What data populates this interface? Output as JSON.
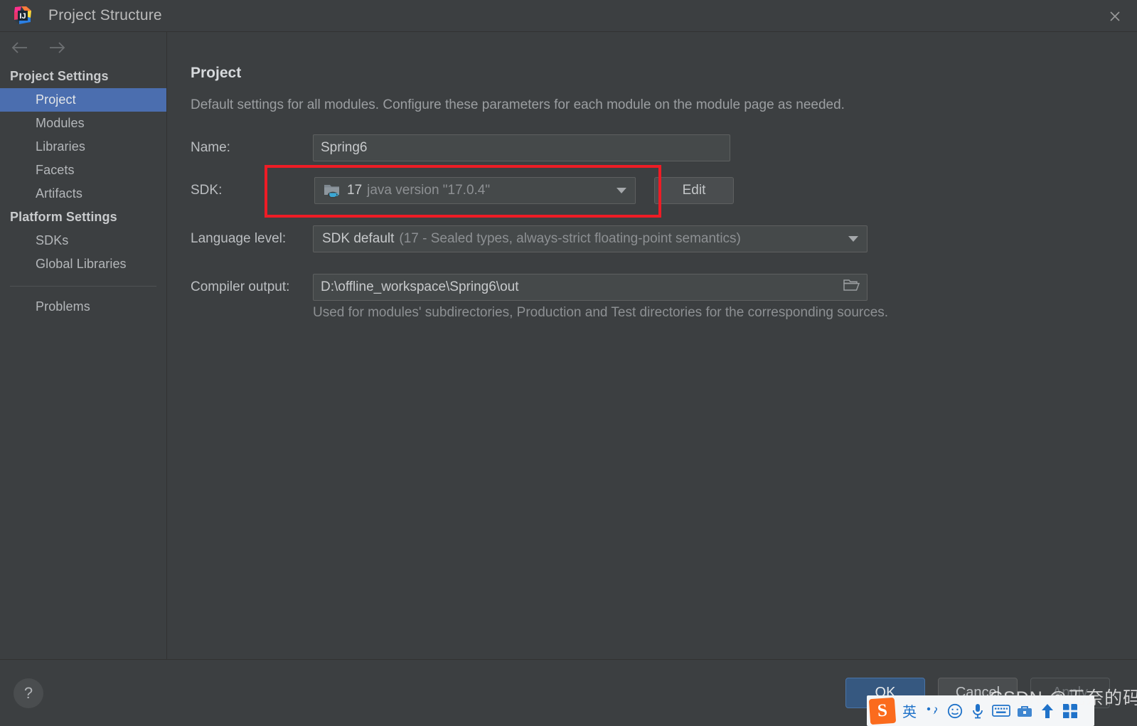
{
  "window": {
    "title": "Project Structure",
    "app_icon": "intellij-idea-logo",
    "close_icon": "close-icon"
  },
  "navbar": {
    "back_icon": "arrow-left-icon",
    "forward_icon": "arrow-right-icon"
  },
  "sidebar": {
    "groups": [
      {
        "label": "Project Settings",
        "items": [
          {
            "label": "Project",
            "selected": true
          },
          {
            "label": "Modules",
            "selected": false
          },
          {
            "label": "Libraries",
            "selected": false
          },
          {
            "label": "Facets",
            "selected": false
          },
          {
            "label": "Artifacts",
            "selected": false
          }
        ]
      },
      {
        "label": "Platform Settings",
        "items": [
          {
            "label": "SDKs",
            "selected": false
          },
          {
            "label": "Global Libraries",
            "selected": false
          }
        ]
      }
    ],
    "extra_item": {
      "label": "Problems",
      "selected": false
    }
  },
  "main": {
    "title": "Project",
    "description": "Default settings for all modules. Configure these parameters for each module on the module page as needed.",
    "fields": {
      "name": {
        "label": "Name:",
        "value": "Spring6"
      },
      "sdk": {
        "label": "SDK:",
        "icon": "java-sdk-folder-icon",
        "value_strong": "17",
        "value_dim": "java version \"17.0.4\"",
        "caret_icon": "chevron-down-icon",
        "edit_button": "Edit"
      },
      "language_level": {
        "label": "Language level:",
        "value_strong": "SDK default",
        "value_dim": "(17 - Sealed types, always-strict floating-point semantics)",
        "caret_icon": "chevron-down-icon"
      },
      "compiler_output": {
        "label": "Compiler output:",
        "value": "D:\\offline_workspace\\Spring6\\out",
        "browse_icon": "folder-open-icon",
        "hint": "Used for modules' subdirectories, Production and Test directories for the corresponding sources."
      }
    }
  },
  "annotation": {
    "highlight_color": "#ee1c25",
    "target": "sdk-field"
  },
  "footer": {
    "help_icon": "?",
    "ok_label": "OK",
    "cancel_label": "Cancel",
    "apply_label": "Apply"
  },
  "ime_toolbar": {
    "logo": "S",
    "mode": "英",
    "punctuation_icon": "punctuation-toggle-icon",
    "emoji_icon": "☺",
    "mic_icon": "microphone-icon",
    "keyboard_icon": "keyboard-icon",
    "tools_icon": "toolbox-icon",
    "upload_icon": "upload-icon",
    "apps_icon": "apps-grid-icon"
  },
  "watermark": {
    "text": "CSDN @无奈的码农"
  },
  "colors": {
    "background": "#3c3f41",
    "selection": "#4b6eaf",
    "accent_ok": "#365880",
    "annotation_red": "#ee1c25"
  }
}
